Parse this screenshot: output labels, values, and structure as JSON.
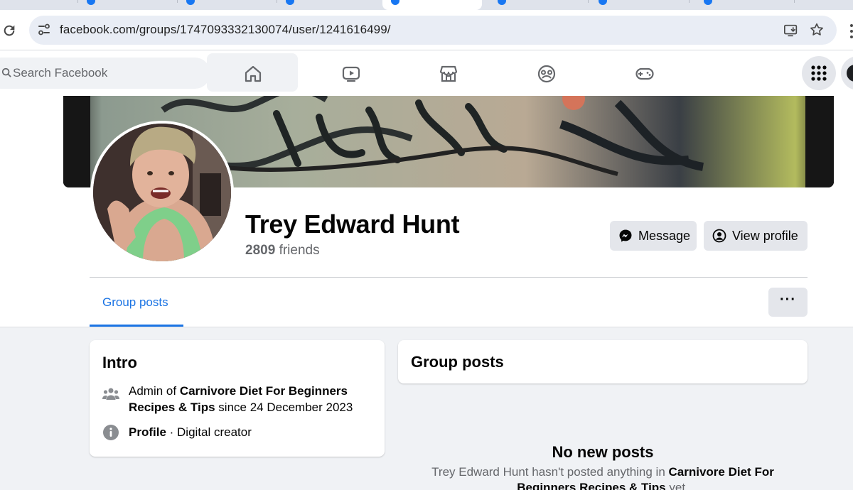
{
  "browser": {
    "url": "facebook.com/groups/1747093332130074/user/1241616499/"
  },
  "fb": {
    "search_placeholder": "Search Facebook",
    "nav": [
      "home",
      "video",
      "marketplace",
      "groups",
      "gaming"
    ]
  },
  "profile": {
    "name": "Trey Edward Hunt",
    "friends_count": "2809",
    "friends_label": "friends",
    "message_label": "Message",
    "view_profile_label": "View profile",
    "tab_group_posts": "Group posts",
    "more_label": "···"
  },
  "intro": {
    "title": "Intro",
    "admin_prefix": "Admin of ",
    "group_name": "Carnivore Diet For Beginners Recipes & Tips",
    "admin_suffix": " since 24 December 2023",
    "profile_label": "Profile",
    "profile_detail": " · Digital creator"
  },
  "group_posts": {
    "title": "Group posts",
    "empty_title": "No new posts",
    "empty_prefix": "Trey Edward Hunt hasn't posted anything in ",
    "empty_group": "Carnivore Diet For Beginners Recipes & Tips",
    "empty_suffix": " yet."
  },
  "colors": {
    "accent": "#1b74e4",
    "page_bg": "#f0f2f5",
    "button_bg": "#e4e6eb",
    "muted_text": "#65676b"
  }
}
